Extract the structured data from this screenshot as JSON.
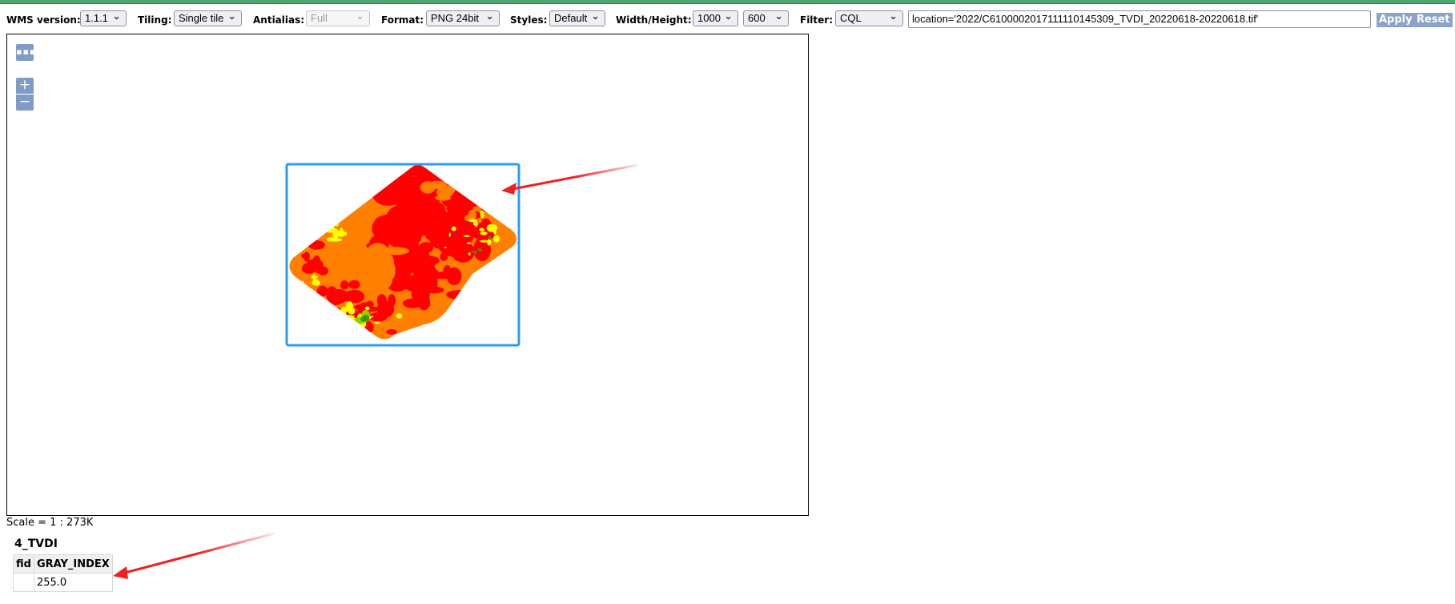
{
  "toolbar": {
    "wms_version": {
      "label": "WMS version:",
      "value": "1.1.1"
    },
    "tiling": {
      "label": "Tiling:",
      "value": "Single tile"
    },
    "antialias": {
      "label": "Antialias:",
      "value": "Full",
      "disabled": true
    },
    "format": {
      "label": "Format:",
      "value": "PNG 24bit"
    },
    "styles": {
      "label": "Styles:",
      "value": "Default"
    },
    "width_height": {
      "label": "Width/Height:",
      "width": "1000",
      "height": "600"
    },
    "filter": {
      "label": "Filter:",
      "type": "CQL",
      "value": "location='2022/C6100002017111110145309_TVDI_20220618-20220618.tif'"
    },
    "apply_label": "Apply",
    "reset_label": "Reset"
  },
  "map": {
    "controls": {
      "more": "▪▪▪",
      "zoom_in": "+",
      "zoom_out": "−"
    },
    "raster_colors": {
      "very_high": "#ff0000",
      "high": "#ff8000",
      "mid": "#ffff00",
      "low": "#99cc00",
      "very_low": "#33a000"
    },
    "selection_color": "#2d9cf0",
    "annotation_color": "#f02020"
  },
  "scale": {
    "text": "Scale = 1 : 273K"
  },
  "feature_info": {
    "layer": "4_TVDI",
    "columns": [
      "fid",
      "GRAY_INDEX"
    ],
    "rows": [
      [
        "",
        "255.0"
      ]
    ]
  }
}
